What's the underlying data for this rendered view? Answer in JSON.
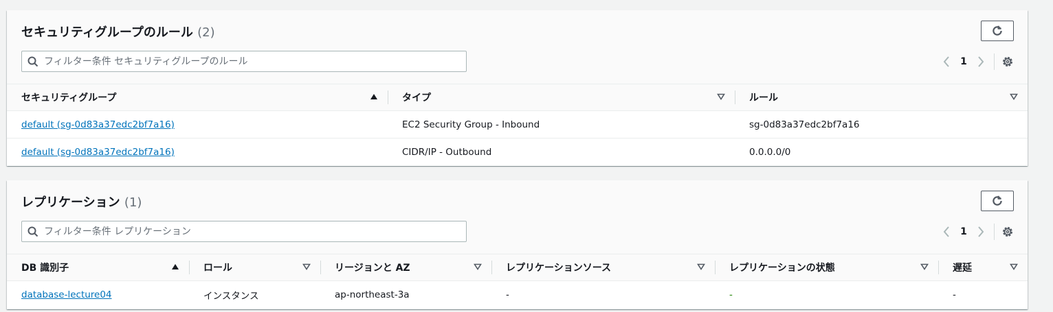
{
  "sg_panel": {
    "title": "セキュリティグループのルール",
    "count": "(2)",
    "filter_placeholder": "フィルター条件 セキュリティグループのルール",
    "page": "1",
    "columns": [
      "セキュリティグループ",
      "タイプ",
      "ルール"
    ],
    "rows": [
      {
        "group": "default (sg-0d83a37edc2bf7a16)",
        "type": "EC2 Security Group - Inbound",
        "rule": "sg-0d83a37edc2bf7a16"
      },
      {
        "group": "default (sg-0d83a37edc2bf7a16)",
        "type": "CIDR/IP - Outbound",
        "rule": "0.0.0.0/0"
      }
    ]
  },
  "rep_panel": {
    "title": "レプリケーション",
    "count": "(1)",
    "filter_placeholder": "フィルター条件 レプリケーション",
    "page": "1",
    "columns": [
      "DB 識別子",
      "ロール",
      "リージョンと AZ",
      "レプリケーションソース",
      "レプリケーションの状態",
      "遅延"
    ],
    "rows": [
      {
        "db_id": "database-lecture04",
        "role": "インスタンス",
        "region_az": "ap-northeast-3a",
        "source": "-",
        "status": "-",
        "lag": "-"
      }
    ]
  },
  "icons": {
    "refresh": "refresh-icon",
    "search": "search-icon",
    "prev": "chevron-left-icon",
    "next": "chevron-right-icon",
    "settings": "gear-icon",
    "sort_asc": "sort-ascending-icon",
    "sort_none": "sort-descending-outline-icon"
  },
  "colors": {
    "link": "#0073bb",
    "status_green": "#1d8102",
    "border": "#aab7b8"
  }
}
